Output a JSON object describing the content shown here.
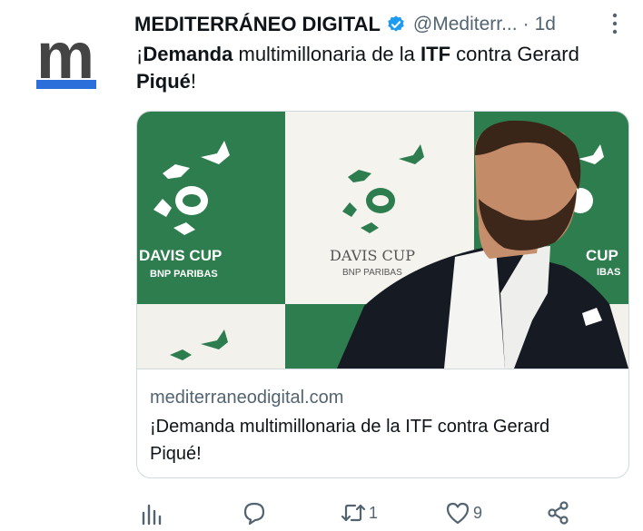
{
  "account": {
    "name": "MEDITERRÁNEO DIGITAL",
    "handle": "@Mediterr...",
    "separator": "·",
    "time": "1d",
    "avatar_letter": "m"
  },
  "tweet": {
    "text_parts": [
      "¡",
      "Demanda",
      " multimillonaria de la ",
      "ITF",
      " contra Gerard ",
      "Piqué",
      "!"
    ]
  },
  "card": {
    "image_text": {
      "logo_left": "DAVIS CUP",
      "sponsor_left": "BNP PARIBAS",
      "logo_center": "DAVIS CUP",
      "sponsor_center": "BNP PARIBAS",
      "logo_right": "CUP",
      "sponsor_right": "IBAS"
    },
    "domain": "mediterraneodigital.com",
    "title": "¡Demanda multimillonaria de la ITF contra Gerard Piqué!"
  },
  "actions": {
    "views_icon": "bar-chart-icon",
    "reply_icon": "speech-bubble-icon",
    "retweet_icon": "retweet-icon",
    "retweet_count": "1",
    "like_icon": "heart-icon",
    "like_count": "9",
    "share_icon": "share-icon"
  },
  "colors": {
    "brand_blue": "#2b6fdb",
    "verified_blue": "#1d9bf0",
    "davis_green": "#2e7d4f",
    "text_secondary": "#536471"
  }
}
